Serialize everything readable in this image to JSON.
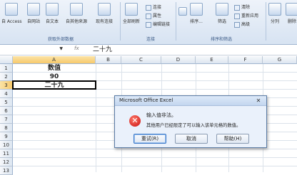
{
  "ribbon": {
    "buttons": [
      {
        "label": "自 Access"
      },
      {
        "label": "自网站"
      },
      {
        "label": "自文本"
      },
      {
        "label": "自其他来源"
      },
      {
        "label": "现有连接"
      },
      {
        "label": "全部刷新"
      },
      {
        "label": "排序..."
      },
      {
        "label": "筛选"
      },
      {
        "label": "分列"
      },
      {
        "label": "删除"
      }
    ],
    "small_items": [
      {
        "label": "连接"
      },
      {
        "label": "属性"
      },
      {
        "label": "编辑链接"
      },
      {
        "label": "清除"
      },
      {
        "label": "重新应用"
      },
      {
        "label": "高级"
      }
    ],
    "groups": [
      {
        "label": "获取外部数据"
      },
      {
        "label": "连接"
      },
      {
        "label": "排序和筛选"
      }
    ]
  },
  "formula_bar": {
    "fx": "fx",
    "content": "二十九"
  },
  "columns": [
    "A",
    "B",
    "C",
    "D",
    "E",
    "F",
    "G"
  ],
  "rows": [
    "1",
    "2",
    "3",
    "4",
    "5",
    "6",
    "7",
    "8",
    "9",
    "10",
    "11",
    "12",
    "13"
  ],
  "cells": {
    "a1": "数值",
    "a2": "90",
    "a3": "二十九"
  },
  "dialog": {
    "title": "Microsoft Office Excel",
    "close": "✕",
    "message1": "输入值非法。",
    "message2": "其他用户已经限定了可以输入该单元格的数值。",
    "buttons": {
      "retry": "重试(R)",
      "cancel": "取消",
      "help": "帮助(H)"
    }
  }
}
